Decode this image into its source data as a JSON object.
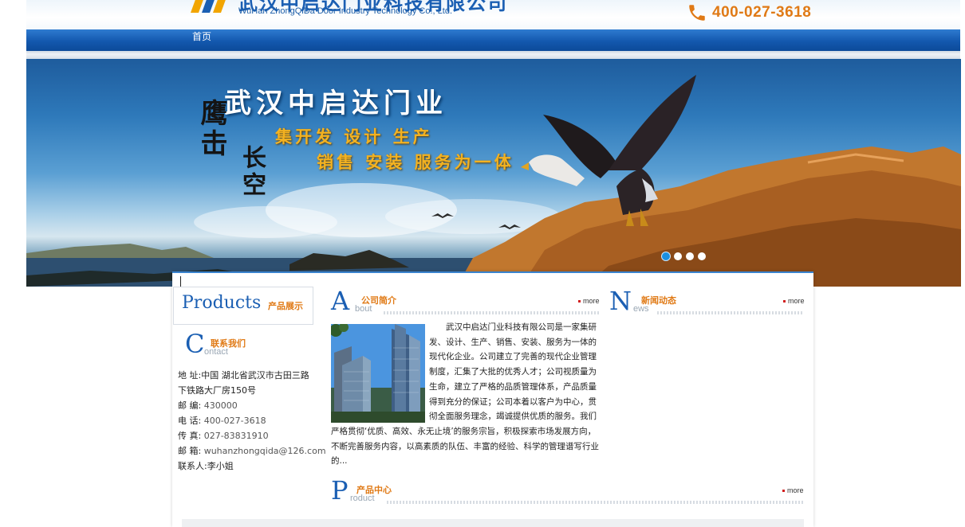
{
  "header": {
    "company_cn": "武汉中启达门业科技有限公司",
    "company_en": "WuHan ZhongQiDa Door Industry Technology Co., Ltd.",
    "hotline": "400-027-3618"
  },
  "nav": {
    "items": [
      {
        "label": "首页"
      }
    ]
  },
  "banner": {
    "title": "武汉中启达门业",
    "line1": "集开发 设计 生产",
    "line2": "销售 安装 服务为一体",
    "calligraphy_1": "鹰击",
    "calligraphy_2": "长空",
    "slides": 4,
    "active_slide": 1
  },
  "sidebar": {
    "products_en": "Products",
    "products_cn": "产品展示",
    "contact": {
      "letter": "C",
      "title_cn": "联系我们",
      "title_en": "ontact",
      "address_label": "地 址:",
      "address": "中国 湖北省武汉市古田三路",
      "address2": "下铁路大厂房150号",
      "postcode_label": "邮 编:",
      "postcode": "430000",
      "phone_label": "电 话:",
      "phone": "400-027-3618",
      "fax_label": "传 真:",
      "fax": "027-83831910",
      "email_label": "邮 箱:",
      "email": "wuhanzhongqida@126.com",
      "contact_label": "联系人:",
      "contact_person": "李小姐"
    }
  },
  "about": {
    "letter": "A",
    "title_cn": "公司简介",
    "title_en": "bout",
    "more": "more",
    "text": "　　武汉中启达门业科技有限公司是一家集研发、设计、生产、销售、安装、服务为一体的现代化企业。公司建立了完善的现代企业管理制度，汇集了大批的优秀人才；公司视质量为生命，建立了严格的品质管理体系，产品质量得到充分的保证；公司本着以客户为中心，贯彻全面服务理念，竭诚提供优质的服务。我们严格贯彻‘优质、高效、永无止境’的服务宗旨，积极探索市场发展方向，不断完善服务内容，以高素质的队伍、丰富的经验、科学的管理谱写行业的..."
  },
  "news": {
    "letter": "N",
    "title_cn": "新闻动态",
    "title_en": "ews",
    "more": "more"
  },
  "product_center": {
    "letter": "P",
    "title_cn": "产品中心",
    "title_en": "roduct",
    "more": "more"
  },
  "colors": {
    "brand_blue": "#1b5fb3",
    "accent_orange": "#e07a16",
    "nav_blue": "#1358ae"
  }
}
